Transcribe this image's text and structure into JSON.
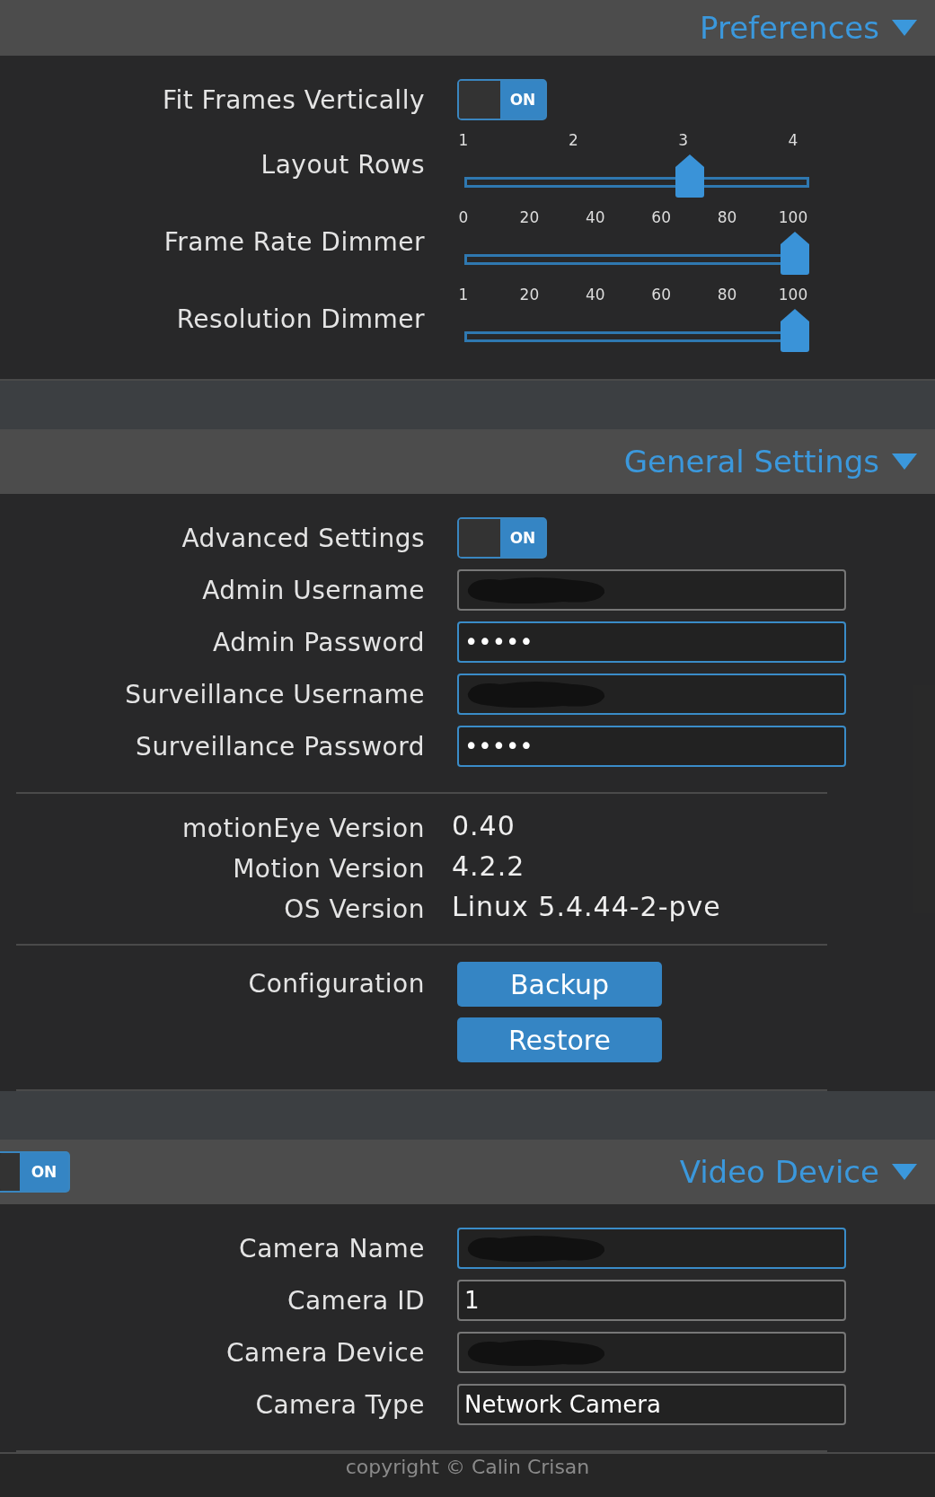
{
  "sections": [
    {
      "title": "Preferences",
      "expanded": true,
      "groups": [
        [
          {
            "kind": "toggle",
            "label": "Fit Frames Vertically",
            "on": true,
            "state_text": "ON"
          },
          {
            "kind": "slider",
            "label": "Layout Rows",
            "ticks": [
              "1",
              "2",
              "3",
              "4"
            ],
            "level": 0.667
          },
          {
            "kind": "slider",
            "label": "Frame Rate Dimmer",
            "ticks": [
              "0",
              "20",
              "40",
              "60",
              "80",
              "100"
            ],
            "level": 1
          },
          {
            "kind": "slider",
            "label": "Resolution Dimmer",
            "ticks": [
              "1",
              "20",
              "40",
              "60",
              "80",
              "100"
            ],
            "level": 1
          }
        ]
      ]
    },
    {
      "title": "General Settings",
      "expanded": true,
      "groups": [
        [
          {
            "kind": "toggle",
            "label": "Advanced Settings",
            "on": true,
            "state_text": "ON"
          },
          {
            "kind": "field",
            "label": "Admin Username",
            "redacted": true,
            "focused": false
          },
          {
            "kind": "field",
            "label": "Admin Password",
            "value": "•••••",
            "focused": true
          },
          {
            "kind": "field",
            "label": "Surveillance Username",
            "redacted": true,
            "focused": true
          },
          {
            "kind": "field",
            "label": "Surveillance Password",
            "value": "•••••",
            "focused": true
          }
        ],
        [
          {
            "kind": "info",
            "label": "motionEye Version",
            "value": "0.40"
          },
          {
            "kind": "info",
            "label": "Motion Version",
            "value": "4.2.2"
          },
          {
            "kind": "info",
            "label": "OS Version",
            "value": "Linux 5.4.44-2-pve"
          }
        ],
        [
          {
            "kind": "buttons",
            "label": "Configuration",
            "buttons": [
              "Backup",
              "Restore"
            ]
          }
        ]
      ]
    },
    {
      "title": "Video Device",
      "expanded": true,
      "toggle": {
        "on": true,
        "state_text": "ON"
      },
      "groups": [
        [
          {
            "kind": "field",
            "label": "Camera Name",
            "redacted": true,
            "focused": true
          },
          {
            "kind": "field",
            "label": "Camera ID",
            "value": "1",
            "focused": false
          },
          {
            "kind": "field",
            "label": "Camera Device",
            "redacted": true,
            "focused": false
          },
          {
            "kind": "field",
            "label": "Camera Type",
            "value": "Network Camera",
            "focused": false
          }
        ]
      ]
    }
  ],
  "footer": "copyright © Calin Crisan"
}
